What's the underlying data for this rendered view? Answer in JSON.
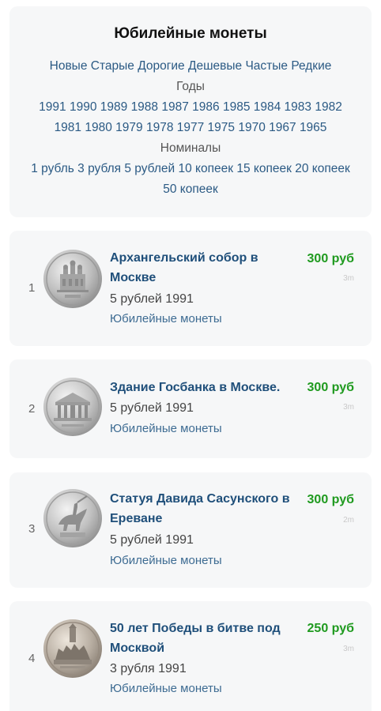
{
  "filters": {
    "title": "Юбилейные монеты",
    "sort_options": [
      "Новые",
      "Старые",
      "Дорогие",
      "Дешевые",
      "Частые",
      "Редкие"
    ],
    "years_heading": "Годы",
    "years_row1": [
      "1991",
      "1990",
      "1989",
      "1988",
      "1987",
      "1986",
      "1985",
      "1984",
      "1983",
      "1982"
    ],
    "years_row2": [
      "1981",
      "1980",
      "1979",
      "1978",
      "1977",
      "1975",
      "1970",
      "1967",
      "1965"
    ],
    "denominations_heading": "Номиналы",
    "denominations_row1": [
      "1 рубль",
      "3 рубля",
      "5 рублей",
      "10 копеек",
      "15 копеек",
      "20 копеек"
    ],
    "denominations_row2": [
      "50 копеек"
    ]
  },
  "coins": [
    {
      "rank": "1",
      "title": "Архангельский собор в Москве",
      "denomination": "5 рублей 1991",
      "category": "Юбилейные монеты",
      "price": "300 руб",
      "time": "3m",
      "icon": "archangel-cathedral-coin-icon"
    },
    {
      "rank": "2",
      "title": "Здание Госбанка в Москве.",
      "denomination": "5 рублей 1991",
      "category": "Юбилейные монеты",
      "price": "300 руб",
      "time": "3m",
      "icon": "state-bank-building-coin-icon"
    },
    {
      "rank": "3",
      "title": "Статуя Давида Сасунского в Ереване",
      "denomination": "5 рублей 1991",
      "category": "Юбилейные монеты",
      "price": "300 руб",
      "time": "2m",
      "icon": "david-of-sasun-statue-coin-icon"
    },
    {
      "rank": "4",
      "title": "50 лет Победы в битве под Москвой",
      "denomination": "3 рубля 1991",
      "category": "Юбилейные монеты",
      "price": "250 руб",
      "time": "3m",
      "icon": "battle-of-moscow-coin-icon"
    }
  ]
}
